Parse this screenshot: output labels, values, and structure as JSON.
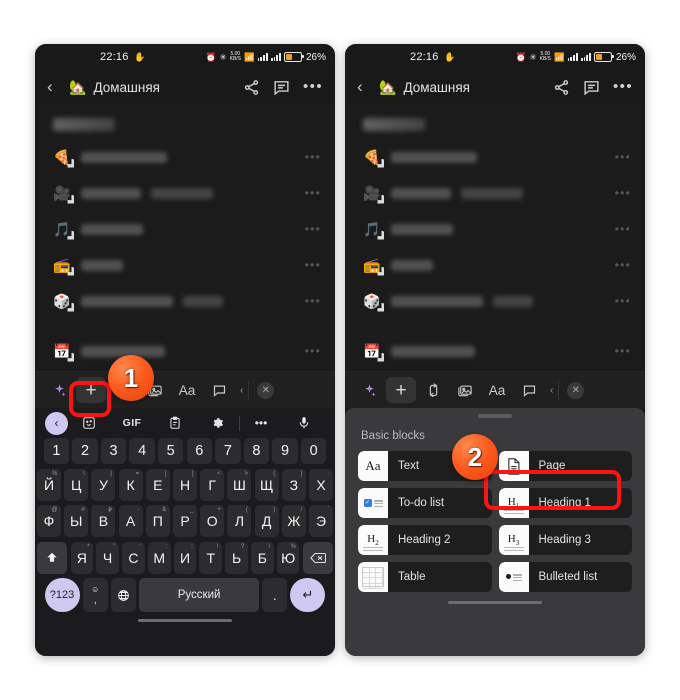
{
  "page": {
    "background": "#ffffff",
    "accent_red": "#fb1412",
    "badge_orange": "#fb5a1e"
  },
  "status_bar": {
    "time": "22:16",
    "battery_percent": "26%",
    "data_rate_top": "5.00",
    "data_rate_bottom": "KB/S",
    "icons": [
      "alarm-icon",
      "bluetooth-icon",
      "data-rate-icon",
      "wifi-icon",
      "signal-icon",
      "signal-icon",
      "battery-icon"
    ]
  },
  "app_header": {
    "back_label": "‹",
    "emoji": "🏡",
    "title": "Домашняя",
    "actions": [
      "share-icon",
      "comment-icon",
      "more-icon"
    ]
  },
  "content_list": {
    "section_title_redacted": true,
    "rows": [
      {
        "emoji": "🍕",
        "redacted": true,
        "width1": 86,
        "width2": 0
      },
      {
        "emoji": "🎥",
        "redacted": true,
        "width1": 60,
        "width2": 62
      },
      {
        "emoji": "🎵",
        "redacted": true,
        "width1": 62,
        "width2": 0
      },
      {
        "emoji": "📻",
        "redacted": true,
        "width1": 42,
        "width2": 0
      },
      {
        "emoji": "🎲",
        "redacted": true,
        "width1": 92,
        "width2": 40
      },
      {
        "emoji": "📅",
        "redacted": true,
        "width1": 84,
        "width2": 0
      }
    ],
    "row_menu": "•••"
  },
  "editor_toolbar": {
    "items": [
      {
        "name": "ai-sparkle-icon",
        "glyph": "✦",
        "selected": false
      },
      {
        "name": "add-block-button",
        "glyph": "+",
        "selected": true
      },
      {
        "name": "move-block-icon",
        "glyph": "↻",
        "selected": false
      },
      {
        "name": "media-icon",
        "glyph": "▣",
        "selected": false
      },
      {
        "name": "text-format-icon",
        "glyph": "Aa",
        "selected": false
      },
      {
        "name": "comment-icon",
        "glyph": "▭",
        "selected": false
      },
      {
        "name": "collapse-chevron-icon",
        "glyph": "‹",
        "selected": false
      },
      {
        "name": "close-toolbar-button",
        "glyph": "✕",
        "selected": false
      }
    ]
  },
  "keyboard": {
    "toolbar": [
      {
        "name": "keyboard-back-button",
        "glyph": "‹"
      },
      {
        "name": "sticker-icon",
        "glyph": ""
      },
      {
        "name": "gif-button",
        "glyph": "GIF"
      },
      {
        "name": "clipboard-icon",
        "glyph": ""
      },
      {
        "name": "settings-gear-icon",
        "glyph": ""
      },
      {
        "name": "more-icon",
        "glyph": "•••"
      },
      {
        "name": "microphone-icon",
        "glyph": ""
      }
    ],
    "row_numbers": [
      "1",
      "2",
      "3",
      "4",
      "5",
      "6",
      "7",
      "8",
      "9",
      "0"
    ],
    "row_1": [
      {
        "k": "Й",
        "s": "%"
      },
      {
        "k": "Ц",
        "s": "\\"
      },
      {
        "k": "У",
        "s": "|"
      },
      {
        "k": "К",
        "s": "="
      },
      {
        "k": "Е",
        "s": "["
      },
      {
        "k": "Н",
        "s": "]"
      },
      {
        "k": "Г",
        "s": "<"
      },
      {
        "k": "Ш",
        "s": ">"
      },
      {
        "k": "Щ",
        "s": "{"
      },
      {
        "k": "З",
        "s": "}"
      },
      {
        "k": "Х",
        "s": "·"
      }
    ],
    "row_2": [
      {
        "k": "Ф",
        "s": "@"
      },
      {
        "k": "Ы",
        "s": "#"
      },
      {
        "k": "В",
        "s": "₽"
      },
      {
        "k": "А",
        "s": "-"
      },
      {
        "k": "П",
        "s": "&"
      },
      {
        "k": "Р",
        "s": "_"
      },
      {
        "k": "О",
        "s": "+"
      },
      {
        "k": "Л",
        "s": "("
      },
      {
        "k": "Д",
        "s": ")"
      },
      {
        "k": "Ж",
        "s": "/"
      },
      {
        "k": "Э",
        "s": "´"
      }
    ],
    "row_3": [
      {
        "k": "Я",
        "s": "*"
      },
      {
        "k": "Ч",
        "s": "\""
      },
      {
        "k": "С",
        "s": "'"
      },
      {
        "k": "М",
        "s": ":"
      },
      {
        "k": "И",
        "s": ";"
      },
      {
        "k": "Т",
        "s": "!"
      },
      {
        "k": "Ь",
        "s": "?"
      },
      {
        "k": "Б",
        "s": "\\"
      },
      {
        "k": "Ю",
        "s": "%"
      }
    ],
    "shift_label": "↑",
    "backspace_label": "⌫",
    "symbols_label": "?123",
    "comma_label": ",",
    "emoji_label": "☺",
    "globe_label": "⊕",
    "space_label": "Русский",
    "period_label": ".",
    "enter_label": "↵"
  },
  "blocks_sheet": {
    "title": "Basic blocks",
    "items": [
      {
        "label": "Text",
        "icon": "text-aa-icon",
        "highlighted": false
      },
      {
        "label": "Page",
        "icon": "page-document-icon",
        "highlighted": true
      },
      {
        "label": "To-do list",
        "icon": "todo-checkbox-icon",
        "highlighted": false
      },
      {
        "label": "Heading 1",
        "icon": "heading-1-icon",
        "highlighted": false
      },
      {
        "label": "Heading 2",
        "icon": "heading-2-icon",
        "highlighted": false
      },
      {
        "label": "Heading 3",
        "icon": "heading-3-icon",
        "highlighted": false
      },
      {
        "label": "Table",
        "icon": "table-icon",
        "highlighted": false
      },
      {
        "label": "Bulleted list",
        "icon": "bulleted-list-icon",
        "highlighted": false
      }
    ]
  },
  "annotations": {
    "step_1": "1",
    "step_2": "2"
  }
}
